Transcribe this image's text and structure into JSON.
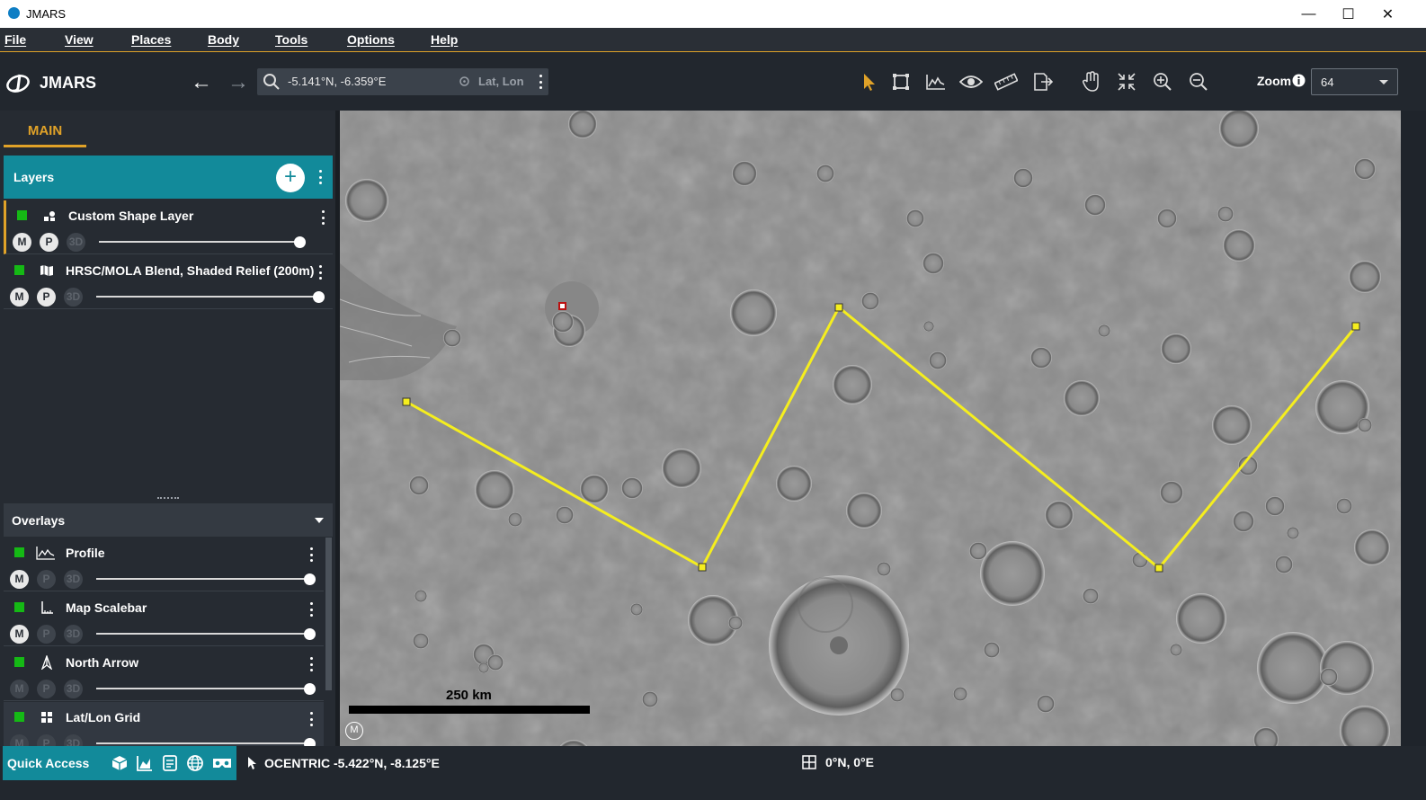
{
  "window": {
    "title": "JMARS",
    "minimize": "—",
    "maximize": "☐",
    "close": "✕"
  },
  "menu": [
    "File",
    "View",
    "Places",
    "Body",
    "Tools",
    "Options",
    "Help"
  ],
  "toolbar": {
    "app_name": "JMARS",
    "search_value": "-5.141°N, -6.359°E",
    "search_mode": "Lat, Lon",
    "zoom_label": "Zoom",
    "zoom_value": "64",
    "tools": [
      "pointer",
      "select-rect",
      "profile",
      "investigate",
      "measure",
      "export",
      "pan",
      "zoom-extent",
      "zoom-in",
      "zoom-out"
    ]
  },
  "left_panel": {
    "tab": "MAIN",
    "layers_title": "Layers",
    "layers": [
      {
        "name": "Custom Shape Layer",
        "icon": "shapes-icon",
        "active": true,
        "opacity": 0.97,
        "buttons": [
          "M",
          "P",
          "3D"
        ]
      },
      {
        "name": "HRSC/MOLA Blend, Shaded Relief (200m)",
        "icon": "map-icon",
        "active": false,
        "opacity": 1.0,
        "buttons": [
          "M",
          "P",
          "3D"
        ]
      }
    ],
    "overlays_title": "Overlays",
    "overlays": [
      {
        "name": "Profile",
        "icon": "profile-icon",
        "opacity": 1.0,
        "buttons": [
          "M",
          "P",
          "3D"
        ]
      },
      {
        "name": "Map Scalebar",
        "icon": "scalebar-icon",
        "opacity": 1.0,
        "buttons": [
          "M",
          "P",
          "3D"
        ]
      },
      {
        "name": "North Arrow",
        "icon": "north-arrow-icon",
        "opacity": 1.0,
        "buttons": [
          "M",
          "P",
          "3D"
        ]
      },
      {
        "name": "Lat/Lon Grid",
        "icon": "grid-icon",
        "opacity": 1.0,
        "buttons": [
          "M",
          "P",
          "3D"
        ]
      }
    ]
  },
  "map": {
    "scalebar_label": "250 km",
    "badge": "M",
    "shape_color": "#f5ee1e"
  },
  "status": {
    "quick_access": "Quick Access",
    "cursor_coords": "OCENTRIC  -5.422°N, -8.125°E",
    "center_coords": "0°N, 0°E"
  }
}
